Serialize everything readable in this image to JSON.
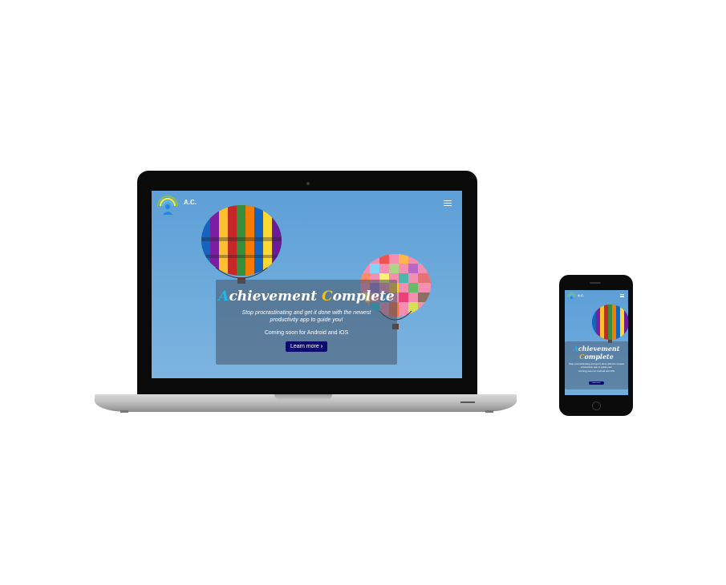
{
  "site": {
    "brand": "A.C.",
    "hero": {
      "title_first_letter": "A",
      "title_first_rest": "chievement ",
      "title_second_letter": "C",
      "title_second_rest": "omplete",
      "tagline": "Stop procrastinating and get it done with the newest productivity app to guide you!",
      "coming_soon": "Coming soon for Android and iOS",
      "cta_label": "Learn more",
      "cta_icon": "chevron-right-icon"
    },
    "menu_icon": "hamburger-menu-icon"
  },
  "colors": {
    "sky": "#6aa8db",
    "accent_blue": "#1fb8e6",
    "accent_gold": "#f1c21b",
    "cta": "#0b0a6e",
    "overlay": "#465264"
  }
}
